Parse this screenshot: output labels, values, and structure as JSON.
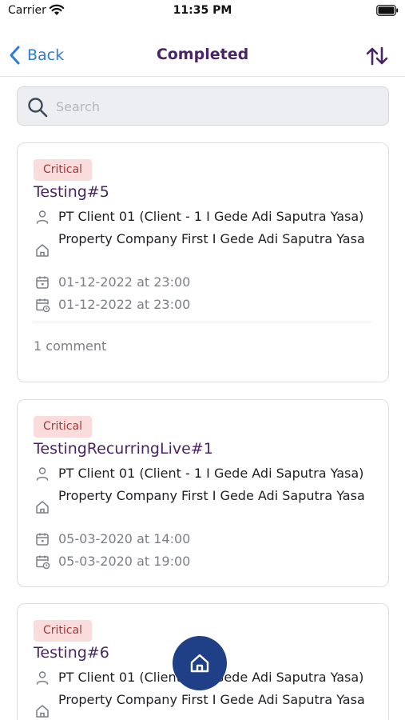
{
  "status_bar": {
    "carrier": "Carrier",
    "time": "11:35 PM"
  },
  "nav": {
    "back_label": "Back",
    "title": "Completed"
  },
  "search": {
    "placeholder": "Search",
    "value": ""
  },
  "icons": {
    "back": "chevron-left-icon",
    "sort": "sort-arrows-icon",
    "search": "search-icon",
    "client": "user-icon",
    "property": "home-icon",
    "start_date": "calendar-icon",
    "end_date": "calendar-clock-icon",
    "fab": "home-icon"
  },
  "colors": {
    "accent": "#2f7bd6",
    "title": "#4a2566",
    "badge_bg": "#fbdcdc",
    "badge_text": "#a03a3a",
    "fab": "#1f3f86"
  },
  "tasks": [
    {
      "priority": "Critical",
      "title": "Testing#5",
      "client": "PT Client 01 (Client - 1 I Gede Adi Saputra Yasa)",
      "property": "Property Company First I Gede Adi Saputra Yasa",
      "start": "01-12-2022 at 23:00",
      "end": "01-12-2022 at 23:00",
      "comments": "1 comment"
    },
    {
      "priority": "Critical",
      "title": "TestingRecurringLive#1",
      "client": "PT Client 01 (Client - 1 I Gede Adi Saputra Yasa)",
      "property": "Property Company First I Gede Adi Saputra Yasa",
      "start": "05-03-2020 at 14:00",
      "end": "05-03-2020 at 19:00"
    },
    {
      "priority": "Critical",
      "title": "Testing#6",
      "client": "PT Client 01 (Client - 1 I Gede Adi Saputra Yasa)",
      "property": "Property Company First I Gede Adi Saputra Yasa"
    }
  ]
}
